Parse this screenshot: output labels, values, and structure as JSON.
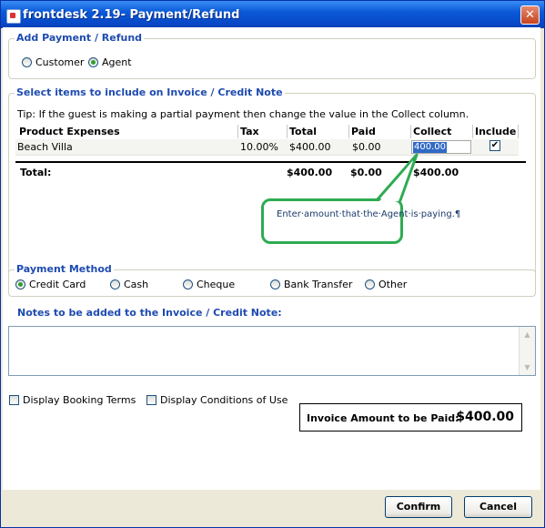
{
  "window": {
    "title": "frontdesk 2.19- Payment/Refund",
    "close_label": "✕"
  },
  "payment_type": {
    "title": "Add Payment / Refund",
    "options": [
      {
        "label": "Customer",
        "selected": false
      },
      {
        "label": "Agent",
        "selected": true
      }
    ]
  },
  "items": {
    "title": "Select items to include on Invoice / Credit Note",
    "tip": "Tip: If the guest is making a partial payment then change the value in the Collect column.",
    "headers": [
      "Product Expenses",
      "Tax Rate",
      "Total",
      "Paid",
      "Collect",
      "Include"
    ],
    "rows": [
      {
        "product": "Beach Villa",
        "tax_rate": "10.00%",
        "total": "$400.00",
        "paid": "$0.00",
        "collect": "400.00",
        "include": true
      }
    ],
    "totals": {
      "label": "Total:",
      "total": "$400.00",
      "paid": "$0.00",
      "collect": "$400.00"
    }
  },
  "callout": {
    "text": "Enter·amount·that·the·Agent·is·paying.¶"
  },
  "payment_method": {
    "title": "Payment Method",
    "options": [
      {
        "label": "Credit Card",
        "selected": true
      },
      {
        "label": "Cash",
        "selected": false
      },
      {
        "label": "Cheque",
        "selected": false
      },
      {
        "label": "Bank Transfer",
        "selected": false
      },
      {
        "label": "Other",
        "selected": false
      }
    ]
  },
  "notes": {
    "title": "Notes to be added to the Invoice / Credit Note:",
    "value": ""
  },
  "options": {
    "display_booking_terms": "Display Booking Terms",
    "display_conditions": "Display Conditions of Use"
  },
  "invoice_amount": {
    "label": "Invoice Amount to be Paid:",
    "value": "$400.00"
  },
  "buttons": {
    "confirm": "Confirm",
    "cancel": "Cancel"
  },
  "colors": {
    "titlebar": "#0a5ad8",
    "group_title": "#1e4bb0",
    "callout_border": "#2eab52",
    "selection": "#316ac5"
  }
}
